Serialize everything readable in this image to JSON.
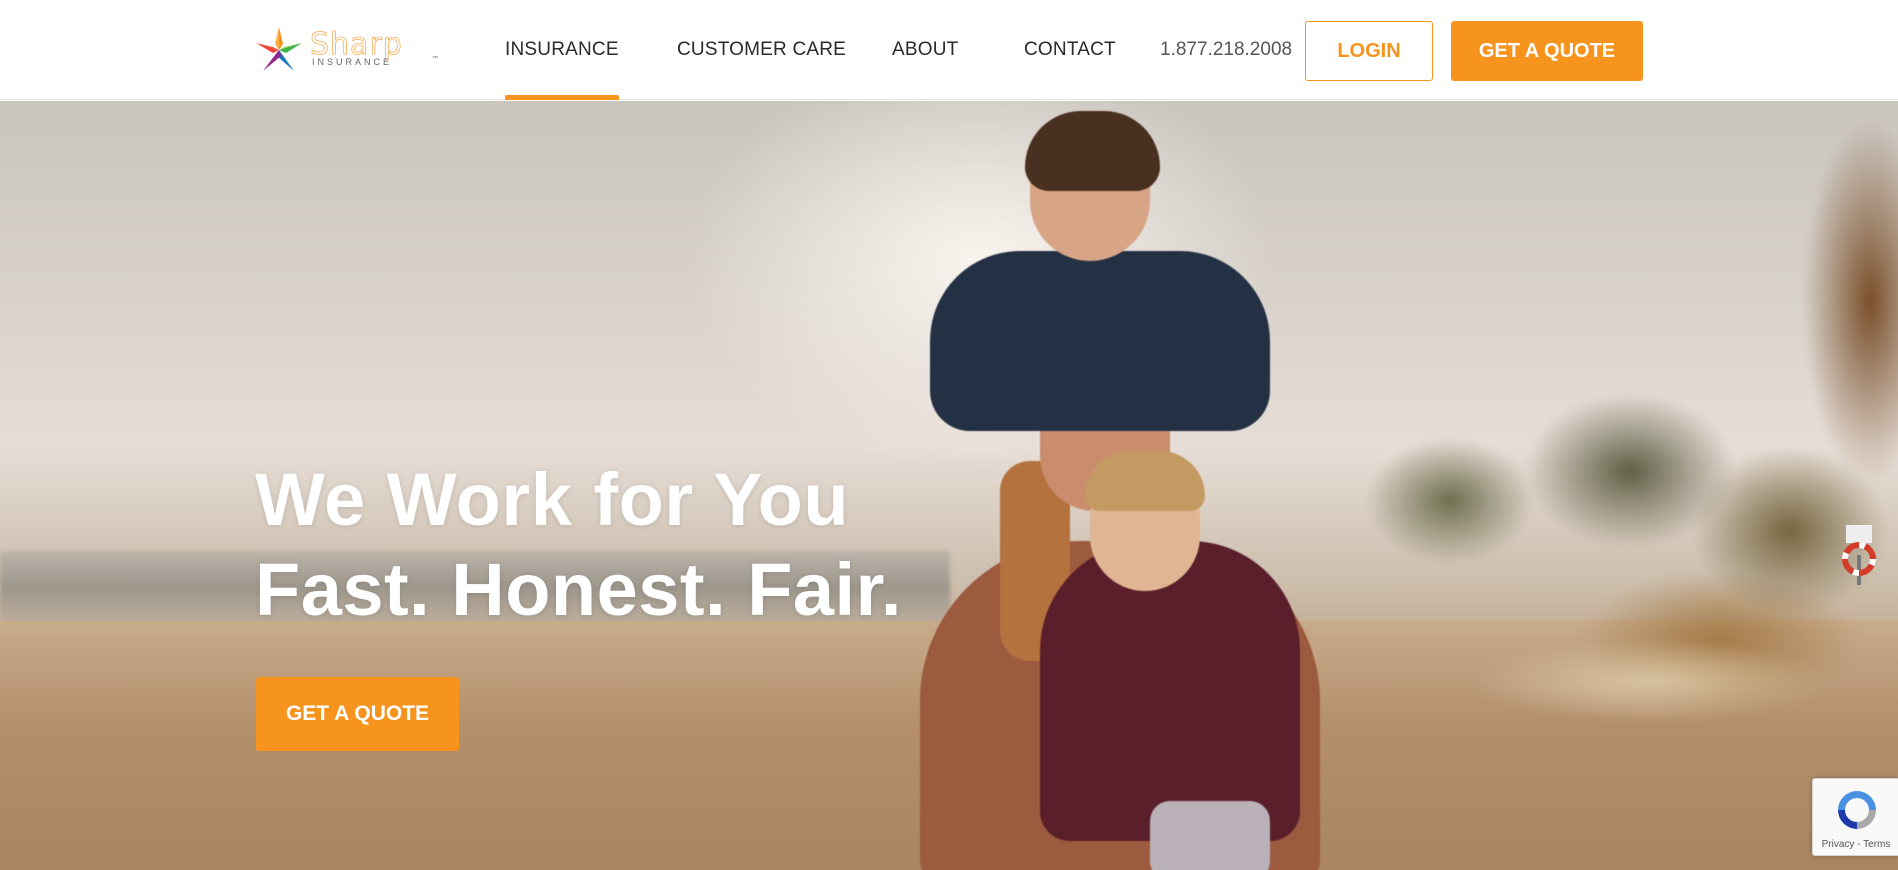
{
  "brand": {
    "name": "Sharp",
    "sub": "INSURANCE",
    "tm": "™",
    "accent": "#f7941d"
  },
  "nav": {
    "items": [
      {
        "label": "INSURANCE",
        "active": true
      },
      {
        "label": "CUSTOMER CARE"
      },
      {
        "label": "ABOUT"
      },
      {
        "label": "CONTACT"
      }
    ],
    "phone": "1.877.218.2008",
    "login_label": "LOGIN",
    "quote_label": "GET A QUOTE"
  },
  "hero": {
    "line1": "We Work for You",
    "line2": "Fast. Honest. Fair.",
    "cta_label": "GET A QUOTE"
  },
  "recaptcha": {
    "links": "Privacy - Terms"
  }
}
